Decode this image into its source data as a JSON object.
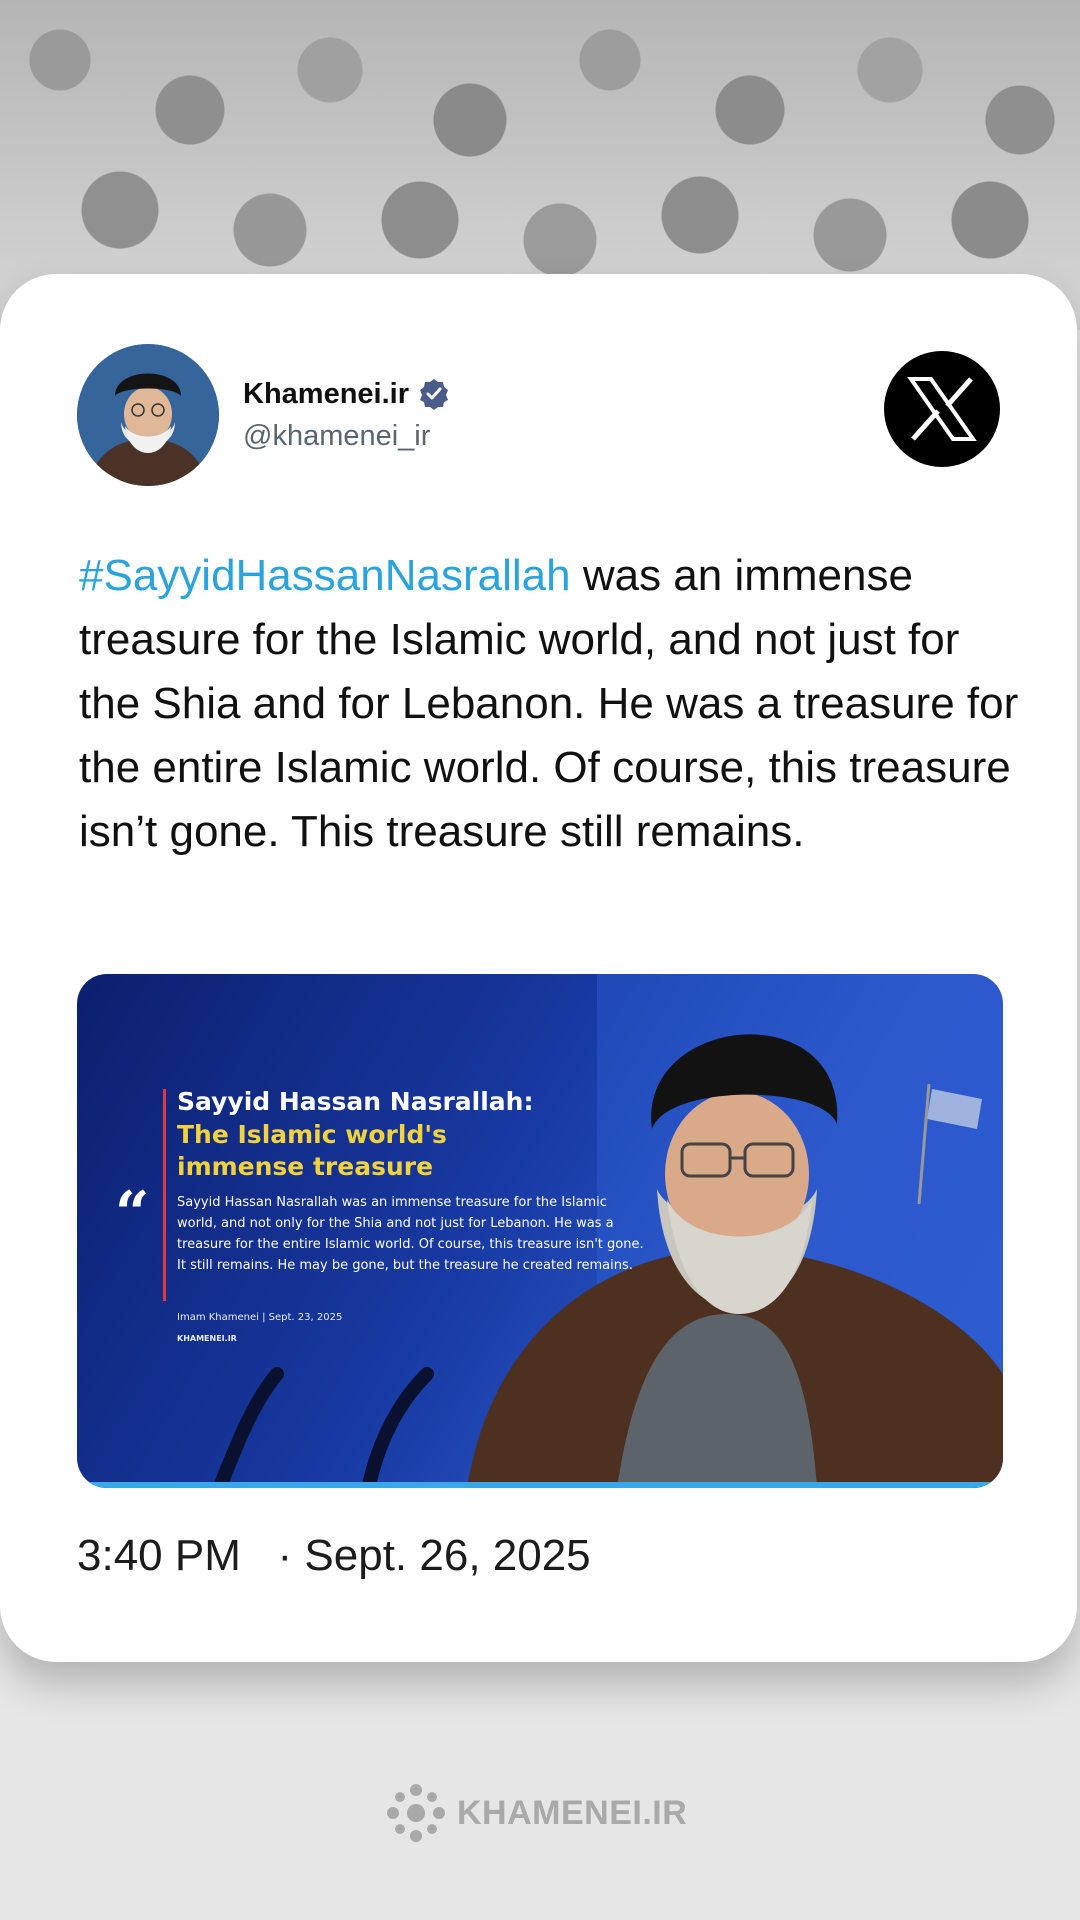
{
  "author": {
    "name": "Khamenei.ir",
    "handle": "@khamenei_ir"
  },
  "tweet": {
    "hashtag": "#SayyidHassanNasrallah",
    "text": " was an immense treasure for the Islamic world, and not just for the Shia and for Lebanon. He was a treasure for the entire Islamic world. Of course, this treasure isn’t gone. This treasure still remains."
  },
  "media": {
    "title": "Sayyid Hassan Nasrallah:",
    "subtitle": "The Islamic world's immense treasure",
    "quote_mark": "“",
    "body": "Sayyid Hassan Nasrallah was an immense treasure for the Islamic world, and not only for the Shia and not just for Lebanon. He was a treasure for the entire Islamic world. Of course, this treasure isn't gone. It still remains. He may be gone, but the treasure he created remains.",
    "attribution": "Imam Khamenei  |  Sept. 23, 2025",
    "brand": "KHAMENEI.IR"
  },
  "timestamp": "3:40 PM   · Sept. 26, 2025",
  "footer": {
    "logo_text": "KHAMENEI.IR"
  },
  "colors": {
    "hashtag": "#2ba3dd",
    "verified": "#4b5c8a",
    "media_accent_bar": "#3aa8e8",
    "media_subtitle": "#f3d33c"
  },
  "icons": [
    "verified-badge-icon",
    "x-logo-icon",
    "khamenei-logo-icon"
  ]
}
